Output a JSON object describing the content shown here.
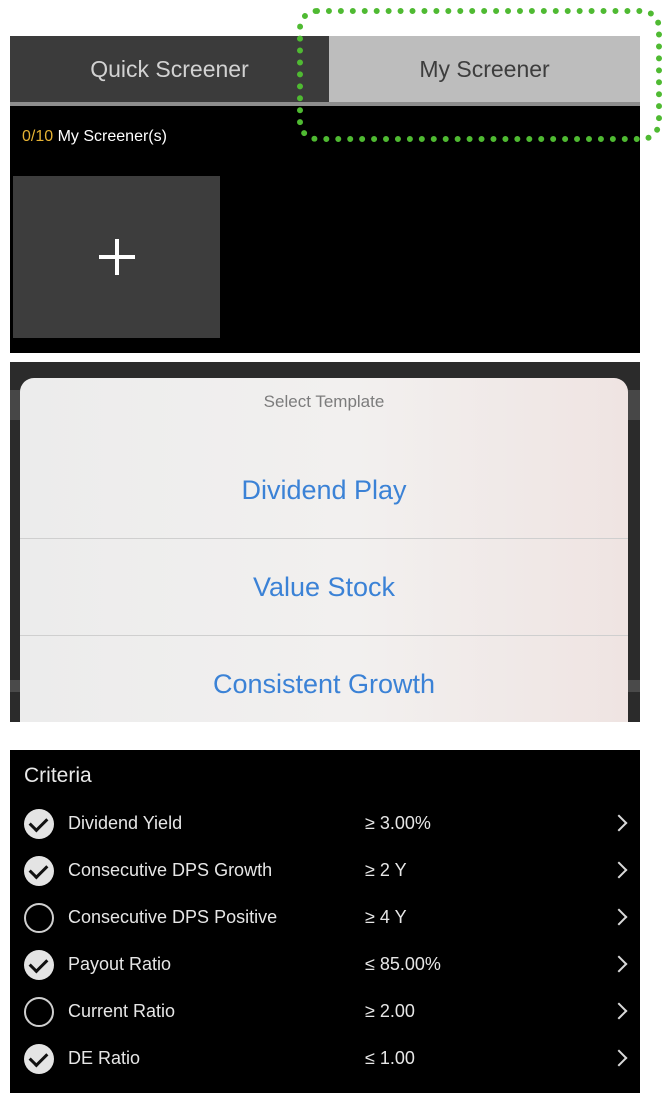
{
  "screener": {
    "tabs": [
      {
        "label": "Quick Screener"
      },
      {
        "label": "My Screener"
      }
    ],
    "count": "0/10",
    "count_label": "My Screener(s)",
    "add_icon": "plus-icon"
  },
  "template_sheet": {
    "title": "Select Template",
    "options": [
      {
        "label": "Dividend Play"
      },
      {
        "label": "Value Stock"
      },
      {
        "label": "Consistent Growth"
      }
    ]
  },
  "criteria": {
    "title": "Criteria",
    "rows": [
      {
        "label": "Dividend Yield",
        "value": "≥ 3.00%",
        "checked": true
      },
      {
        "label": "Consecutive DPS Growth",
        "value": "≥ 2 Y",
        "checked": true
      },
      {
        "label": "Consecutive DPS Positive",
        "value": "≥ 4 Y",
        "checked": false
      },
      {
        "label": "Payout Ratio",
        "value": "≤ 85.00%",
        "checked": true
      },
      {
        "label": "Current Ratio",
        "value": "≥ 2.00",
        "checked": false
      },
      {
        "label": "DE Ratio",
        "value": "≤ 1.00",
        "checked": true
      }
    ]
  },
  "colors": {
    "highlight": "#4fba32",
    "count_accent": "#e5b233",
    "option_text": "#3b82d6"
  }
}
